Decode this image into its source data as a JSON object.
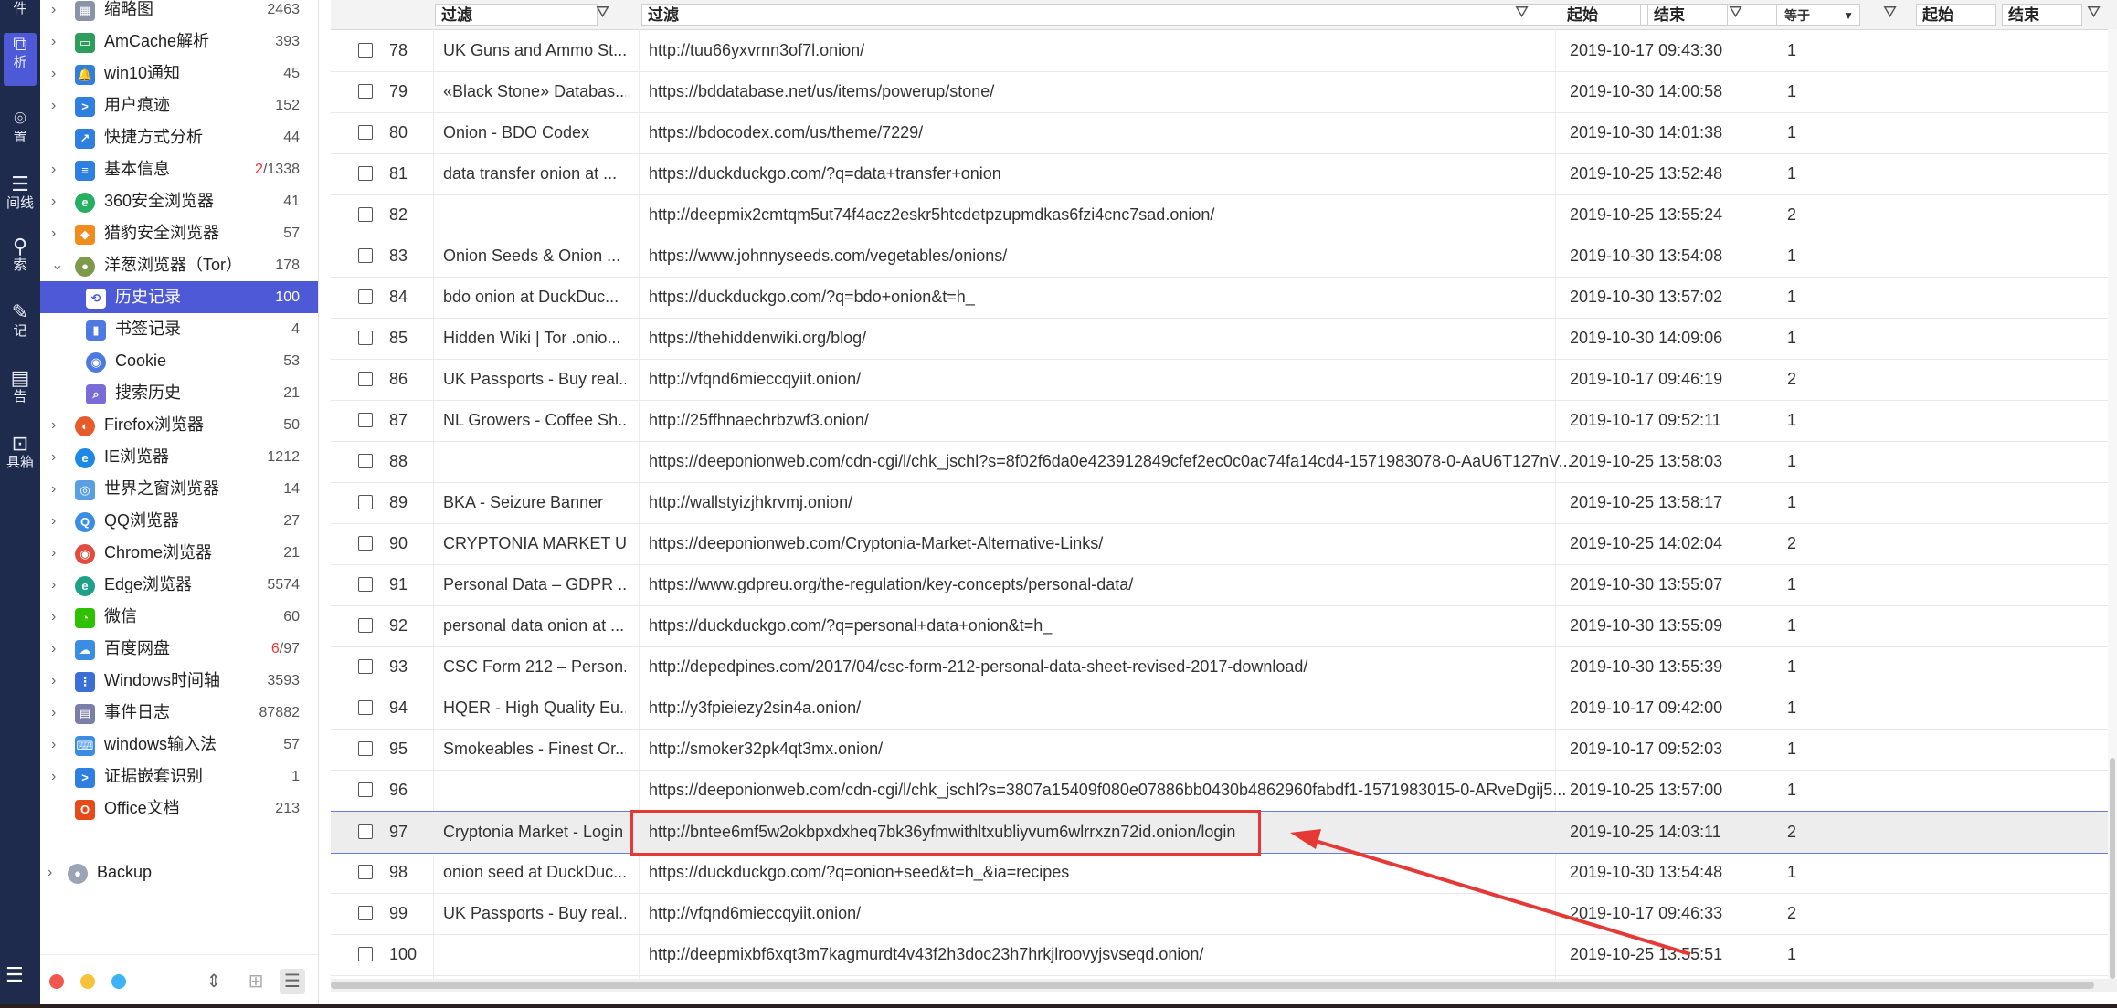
{
  "rail": {
    "top_label": "件",
    "items": [
      {
        "label": "析",
        "icon": "analysis-icon"
      },
      {
        "label": "置",
        "icon": "location-icon"
      },
      {
        "label": "间线",
        "icon": "timeline-icon"
      },
      {
        "label": "索",
        "icon": "search-icon"
      },
      {
        "label": "记",
        "icon": "note-icon"
      },
      {
        "label": "告",
        "icon": "report-icon"
      },
      {
        "label": "具箱",
        "icon": "toolbox-icon"
      }
    ]
  },
  "tree": {
    "items": [
      {
        "label": "缩略图",
        "count": "2463",
        "icon": "thumbnail-icon"
      },
      {
        "label": "AmCache解析",
        "count": "393",
        "icon": "amcache-icon"
      },
      {
        "label": "win10通知",
        "count": "45",
        "icon": "bell-icon"
      },
      {
        "label": "用户痕迹",
        "count": "152",
        "icon": "terminal-icon"
      },
      {
        "label": "快捷方式分析",
        "count": "44",
        "icon": "shortcut-icon"
      },
      {
        "label": "基本信息",
        "count_red": "2",
        "count_rest": "/1338",
        "icon": "info-list-icon"
      },
      {
        "label": "360安全浏览器",
        "count": "41",
        "icon": "360-browser-icon"
      },
      {
        "label": "猎豹安全浏览器",
        "count": "57",
        "icon": "cheetah-browser-icon"
      },
      {
        "label": "洋葱浏览器（Tor）",
        "count": "178",
        "icon": "tor-browser-icon"
      },
      {
        "label": "历史记录",
        "count": "100",
        "icon": "history-icon"
      },
      {
        "label": "书签记录",
        "count": "4",
        "icon": "bookmark-icon"
      },
      {
        "label": "Cookie",
        "count": "53",
        "icon": "cookie-icon"
      },
      {
        "label": "搜索历史",
        "count": "21",
        "icon": "search-history-icon"
      },
      {
        "label": "Firefox浏览器",
        "count": "50",
        "icon": "firefox-icon"
      },
      {
        "label": "IE浏览器",
        "count": "1212",
        "icon": "ie-icon"
      },
      {
        "label": "世界之窗浏览器",
        "count": "14",
        "icon": "theworld-icon"
      },
      {
        "label": "QQ浏览器",
        "count": "27",
        "icon": "qq-browser-icon"
      },
      {
        "label": "Chrome浏览器",
        "count": "21",
        "icon": "chrome-icon"
      },
      {
        "label": "Edge浏览器",
        "count": "5574",
        "icon": "edge-icon"
      },
      {
        "label": "微信",
        "count": "60",
        "icon": "wechat-icon"
      },
      {
        "label": "百度网盘",
        "count_red": "6",
        "count_rest": "/97",
        "icon": "baidu-pan-icon"
      },
      {
        "label": "Windows时间轴",
        "count": "3593",
        "icon": "windows-timeline-icon"
      },
      {
        "label": "事件日志",
        "count": "87882",
        "icon": "event-log-icon"
      },
      {
        "label": "windows输入法",
        "count": "57",
        "icon": "keyboard-icon"
      },
      {
        "label": "证据嵌套识别",
        "count": "1",
        "icon": "evidence-icon"
      },
      {
        "label": "Office文档",
        "count": "213",
        "icon": "office-icon"
      },
      {
        "label": "Backup",
        "count": "",
        "icon": "apple-icon"
      }
    ],
    "colors": {
      "dot_red": "#f0584f",
      "dot_yellow": "#f5c23b",
      "dot_blue": "#3bb3f5",
      "selected": "#4d59d6"
    }
  },
  "filters": {
    "title_placeholder": "过滤",
    "url_placeholder": "过滤",
    "date_start": "起始",
    "date_end": "结束",
    "count_op": "等于",
    "count_start": "起始",
    "count_end": "结束"
  },
  "rows": [
    {
      "idx": "78",
      "title": "UK Guns and Ammo St...",
      "url": "http://tuu66yxvrnn3of7l.onion/",
      "date": "2019-10-17 09:43:30",
      "count": "1"
    },
    {
      "idx": "79",
      "title": "«Black Stone» Databas...",
      "url": "https://bddatabase.net/us/items/powerup/stone/",
      "date": "2019-10-30 14:00:58",
      "count": "1"
    },
    {
      "idx": "80",
      "title": "Onion - BDO Codex",
      "url": "https://bdocodex.com/us/theme/7229/",
      "date": "2019-10-30 14:01:38",
      "count": "1"
    },
    {
      "idx": "81",
      "title": "data transfer onion at ...",
      "url": "https://duckduckgo.com/?q=data+transfer+onion",
      "date": "2019-10-25 13:52:48",
      "count": "1"
    },
    {
      "idx": "82",
      "title": "",
      "url": "http://deepmix2cmtqm5ut74f4acz2eskr5htcdetpzupmdkas6fzi4cnc7sad.onion/",
      "date": "2019-10-25 13:55:24",
      "count": "2"
    },
    {
      "idx": "83",
      "title": "Onion Seeds & Onion ...",
      "url": "https://www.johnnyseeds.com/vegetables/onions/",
      "date": "2019-10-30 13:54:08",
      "count": "1"
    },
    {
      "idx": "84",
      "title": "bdo onion at DuckDuc...",
      "url": "https://duckduckgo.com/?q=bdo+onion&t=h_",
      "date": "2019-10-30 13:57:02",
      "count": "1"
    },
    {
      "idx": "85",
      "title": "Hidden Wiki | Tor .onio...",
      "url": "https://thehiddenwiki.org/blog/",
      "date": "2019-10-30 14:09:06",
      "count": "1"
    },
    {
      "idx": "86",
      "title": "UK Passports - Buy real...",
      "url": "http://vfqnd6mieccqyiit.onion/",
      "date": "2019-10-17 09:46:19",
      "count": "2"
    },
    {
      "idx": "87",
      "title": "NL Growers - Coffee Sh...",
      "url": "http://25ffhnaechrbzwf3.onion/",
      "date": "2019-10-17 09:52:11",
      "count": "1"
    },
    {
      "idx": "88",
      "title": "",
      "url": "https://deeponionweb.com/cdn-cgi/l/chk_jschl?s=8f02f6da0e423912849cfef2ec0c0ac74fa14cd4-1571983078-0-AaU6T127nV...",
      "date": "2019-10-25 13:58:03",
      "count": "1"
    },
    {
      "idx": "89",
      "title": "BKA - Seizure Banner",
      "url": "http://wallstyizjhkrvmj.onion/",
      "date": "2019-10-25 13:58:17",
      "count": "1"
    },
    {
      "idx": "90",
      "title": "CRYPTONIA MARKET U...",
      "url": "https://deeponionweb.com/Cryptonia-Market-Alternative-Links/",
      "date": "2019-10-25 14:02:04",
      "count": "2"
    },
    {
      "idx": "91",
      "title": "Personal Data – GDPR ...",
      "url": "https://www.gdpreu.org/the-regulation/key-concepts/personal-data/",
      "date": "2019-10-30 13:55:07",
      "count": "1"
    },
    {
      "idx": "92",
      "title": "personal data onion at ...",
      "url": "https://duckduckgo.com/?q=personal+data+onion&t=h_",
      "date": "2019-10-30 13:55:09",
      "count": "1"
    },
    {
      "idx": "93",
      "title": "CSC Form 212 – Person...",
      "url": "http://depedpines.com/2017/04/csc-form-212-personal-data-sheet-revised-2017-download/",
      "date": "2019-10-30 13:55:39",
      "count": "1"
    },
    {
      "idx": "94",
      "title": "HQER - High Quality Eu...",
      "url": "http://y3fpieiezy2sin4a.onion/",
      "date": "2019-10-17 09:42:00",
      "count": "1"
    },
    {
      "idx": "95",
      "title": "Smokeables - Finest Or...",
      "url": "http://smoker32pk4qt3mx.onion/",
      "date": "2019-10-17 09:52:03",
      "count": "1"
    },
    {
      "idx": "96",
      "title": "",
      "url": "https://deeponionweb.com/cdn-cgi/l/chk_jschl?s=3807a15409f080e07886bb0430b4862960fabdf1-1571983015-0-ARveDgij5...",
      "date": "2019-10-25 13:57:00",
      "count": "1"
    },
    {
      "idx": "97",
      "title": "Cryptonia Market - Login",
      "url": "http://bntee6mf5w2okbpxdxheq7bk36yfmwithltxubliyvum6wlrrxzn72id.onion/login",
      "date": "2019-10-25 14:03:11",
      "count": "2"
    },
    {
      "idx": "98",
      "title": "onion seed at DuckDuc...",
      "url": "https://duckduckgo.com/?q=onion+seed&t=h_&ia=recipes",
      "date": "2019-10-30 13:54:48",
      "count": "1"
    },
    {
      "idx": "99",
      "title": "UK Passports - Buy real...",
      "url": "http://vfqnd6mieccqyiit.onion/",
      "date": "2019-10-17 09:46:33",
      "count": "2"
    },
    {
      "idx": "100",
      "title": "",
      "url": "http://deepmixbf6xqt3m7kagmurdt4v43f2h3doc23h7hrkjlroovyjsvseqd.onion/",
      "date": "2019-10-25 13:55:51",
      "count": "1"
    }
  ],
  "annotation": {
    "color": "#e53935"
  }
}
